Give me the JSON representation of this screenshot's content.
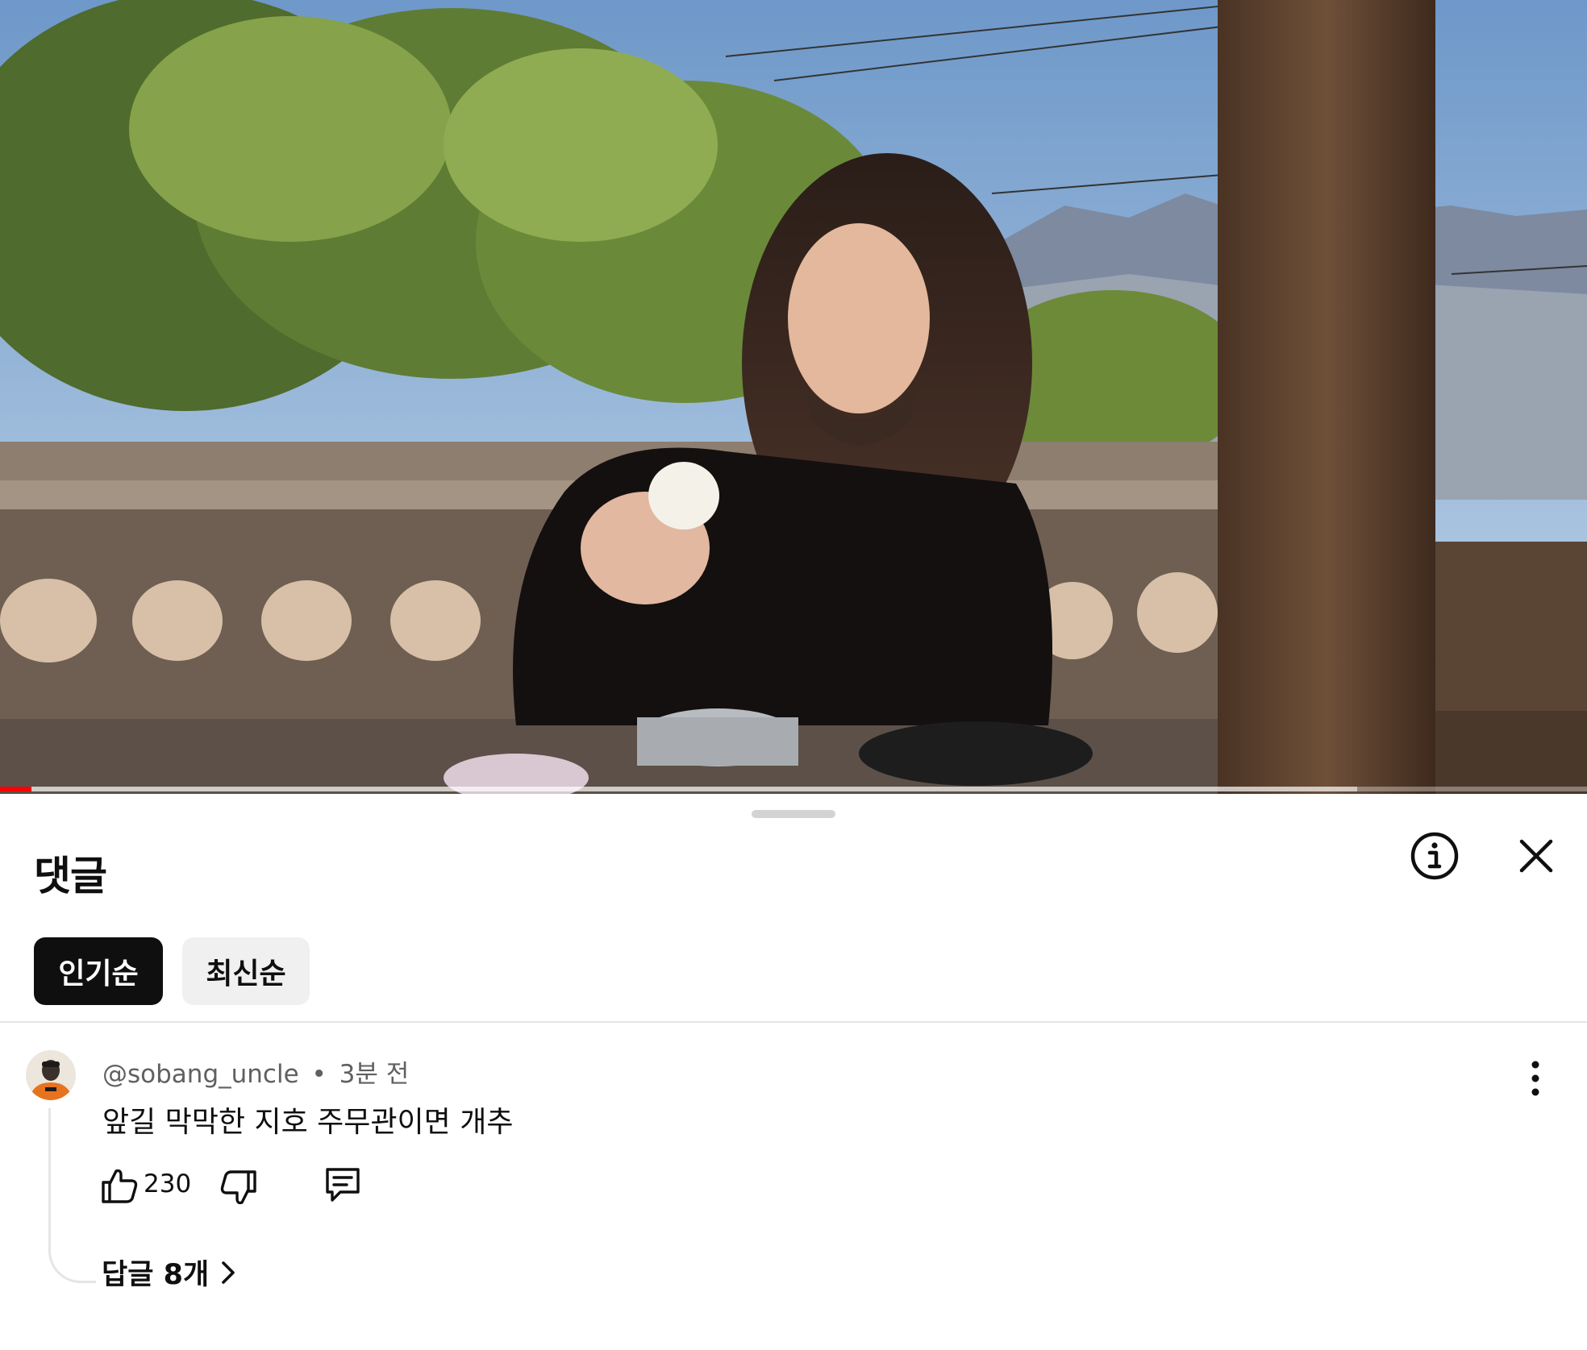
{
  "video": {
    "progress_fraction": 0.02,
    "buffered_fraction": 0.855,
    "progress_color": "#ff0000"
  },
  "comments_panel": {
    "title": "댓글",
    "icons": {
      "info": "info-icon",
      "close": "close-icon"
    },
    "sort_chips": [
      {
        "label": "인기순",
        "selected": true
      },
      {
        "label": "최신순",
        "selected": false
      }
    ]
  },
  "comment": {
    "username": "@sobang_uncle",
    "separator": "•",
    "timestamp": "3분 전",
    "text": "앞길 막막한 지호 주무관이면 개추",
    "like_count": "230",
    "icons": {
      "like": "thumbs-up-icon",
      "dislike": "thumbs-down-icon",
      "reply": "reply-icon",
      "more": "more-vert-icon"
    },
    "replies_label": "답글 8개"
  }
}
